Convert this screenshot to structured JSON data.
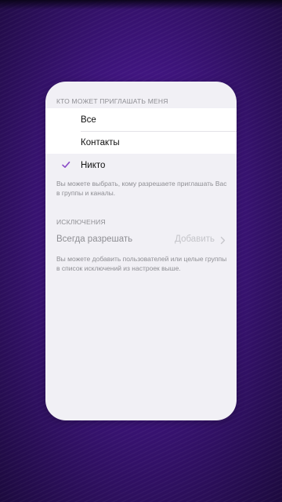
{
  "invite_section": {
    "header": "КТО МОЖЕТ ПРИГЛАШАТЬ МЕНЯ",
    "options": [
      {
        "label": "Все",
        "selected": false
      },
      {
        "label": "Контакты",
        "selected": false
      },
      {
        "label": "Никто",
        "selected": true
      }
    ],
    "footnote": "Вы можете выбрать, кому разрешаете приглашать Вас в группы и каналы."
  },
  "exceptions_section": {
    "header": "ИСКЛЮЧЕНИЯ",
    "row": {
      "label": "Всегда разрешать",
      "action": "Добавить"
    },
    "footnote": "Вы можете добавить пользователей или целые группы в список исключений из настроек выше."
  },
  "colors": {
    "accent": "#8a4cc7",
    "background": "#3c1479",
    "card": "#f1f0f5"
  },
  "icons": {
    "selected": "checkmark-icon",
    "disclosure": "chevron-right-icon"
  }
}
